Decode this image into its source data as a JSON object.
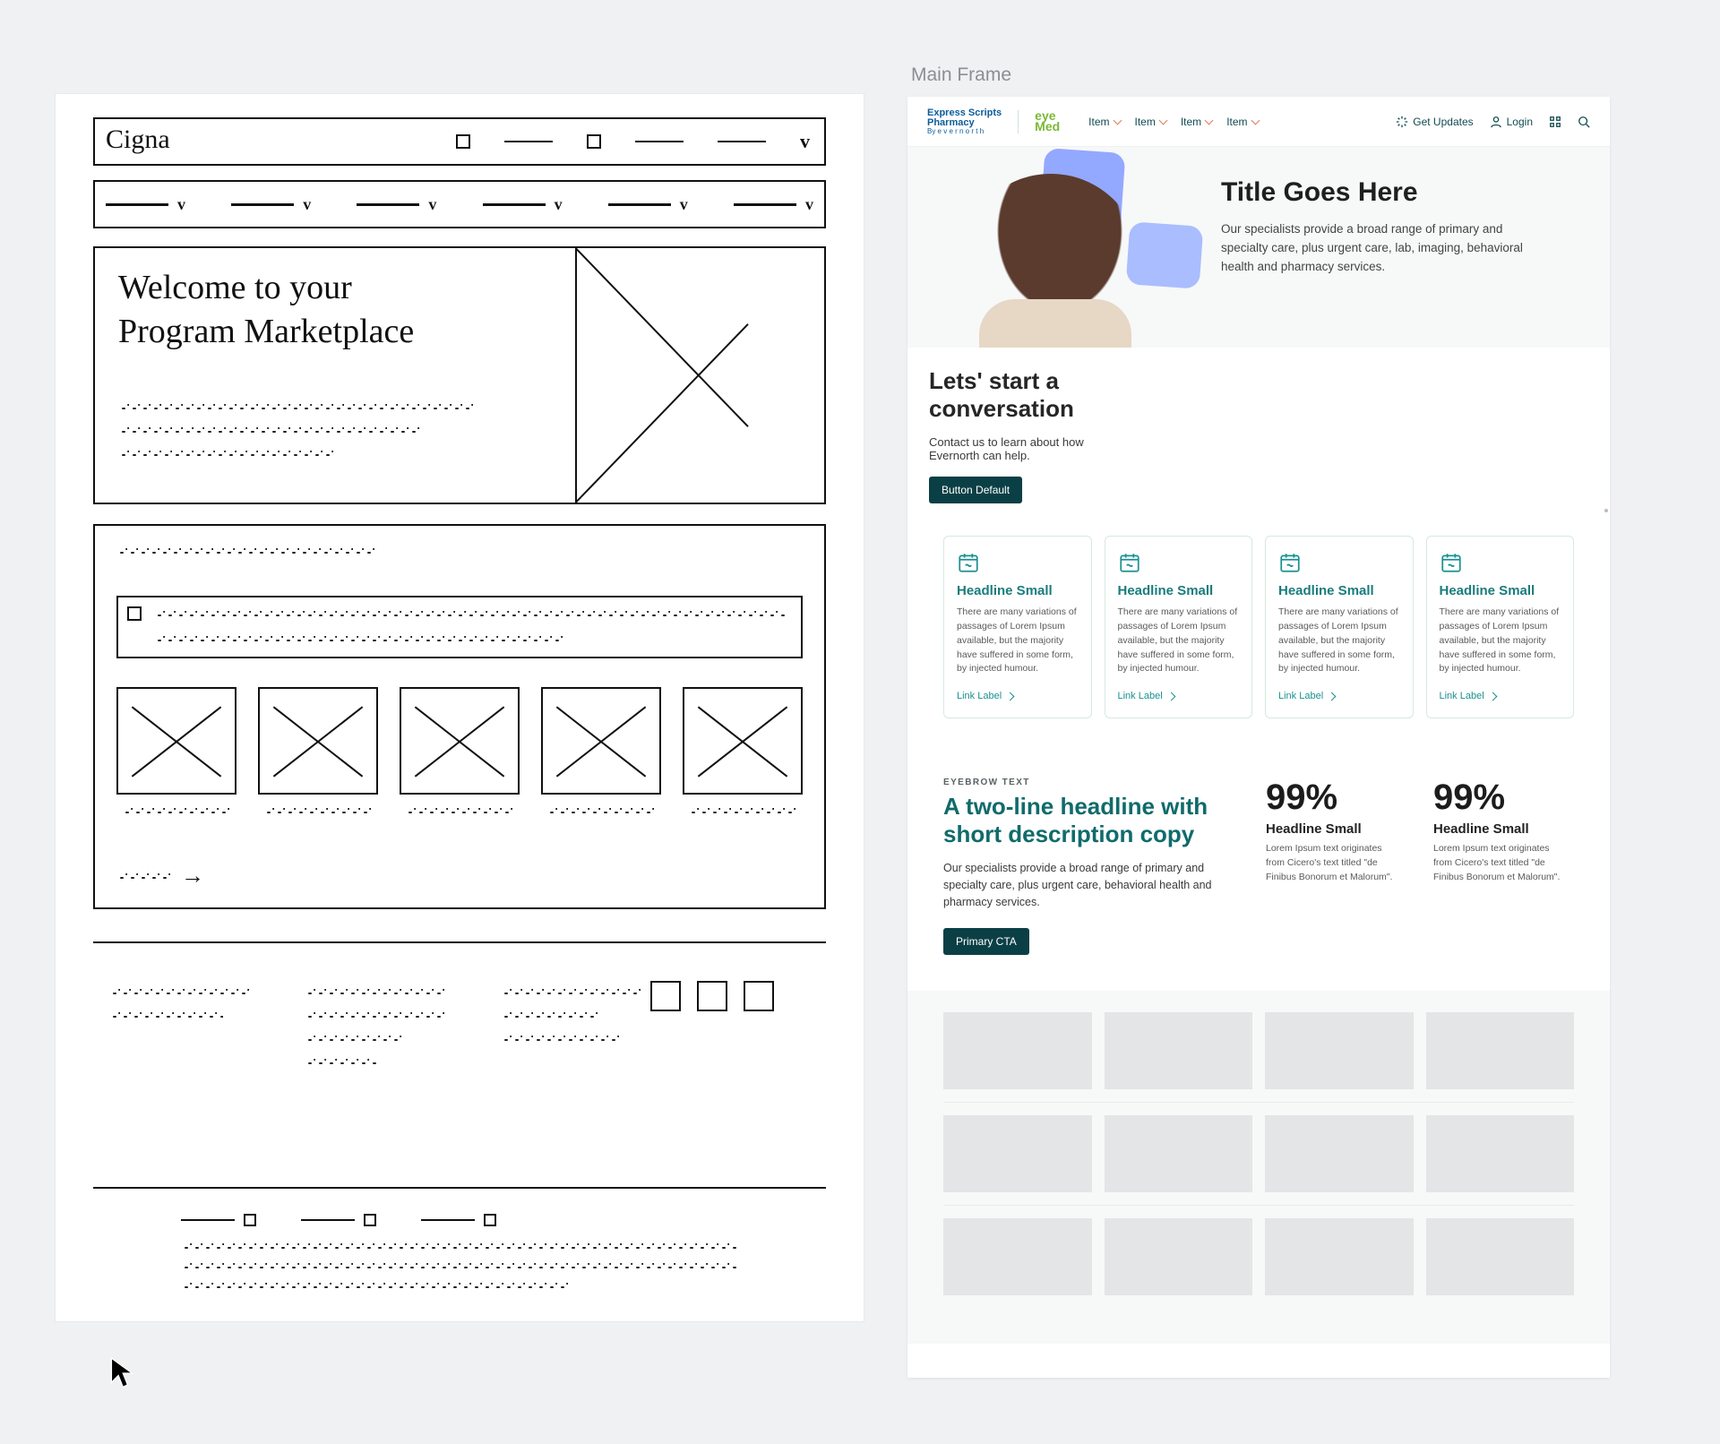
{
  "frameLabel": "Main Frame",
  "sketch": {
    "brand": "Cigna",
    "hero": {
      "title_l1": "Welcome to your",
      "title_l2": "Program Marketplace"
    }
  },
  "mock": {
    "nav": {
      "logoA_l1": "Express Scripts",
      "logoA_l2": "Pharmacy",
      "logoA_sub": "By   e v e r n o r t h",
      "logoB_l1": "eye",
      "logoB_l2": "Med",
      "menu": [
        "Item",
        "Item",
        "Item",
        "Item"
      ],
      "updates": "Get Updates",
      "login": "Login"
    },
    "hero": {
      "title": "Title Goes Here",
      "body": "Our specialists provide a broad range of primary and specialty care, plus urgent care, lab, imaging, behavioral health and pharmacy services."
    },
    "convo": {
      "title": "Lets' start a conversation",
      "body": "Contact us to learn about how Evernorth can help.",
      "button": "Button Default"
    },
    "cards": [
      {
        "title": "Headline Small",
        "body": "There are many variations of passages of Lorem Ipsum available, but the majority have suffered in some form, by injected humour.",
        "link": "Link Label"
      },
      {
        "title": "Headline Small",
        "body": "There are many variations of passages of Lorem Ipsum available, but the majority have suffered in some form, by injected humour.",
        "link": "Link Label"
      },
      {
        "title": "Headline Small",
        "body": "There are many variations of passages of Lorem Ipsum available, but the majority have suffered in some form, by injected humour.",
        "link": "Link Label"
      },
      {
        "title": "Headline Small",
        "body": "There are many variations of passages of Lorem Ipsum available, but the majority have suffered in some form, by injected humour.",
        "link": "Link Label"
      }
    ],
    "stats": {
      "eyebrow": "EYEBROW TEXT",
      "headline": "A two-line headline with short description copy",
      "body": "Our specialists provide a broad range of primary and specialty care, plus urgent care, behavioral health and pharmacy services.",
      "cta": "Primary CTA",
      "items": [
        {
          "big": "99%",
          "hd": "Headline Small",
          "body": "Lorem Ipsum text originates from Cicero's text titled \"de Finibus Bonorum et Malorum\"."
        },
        {
          "big": "99%",
          "hd": "Headline Small",
          "body": "Lorem Ipsum text originates from Cicero's text titled \"de Finibus Bonorum et Malorum\"."
        }
      ]
    }
  }
}
